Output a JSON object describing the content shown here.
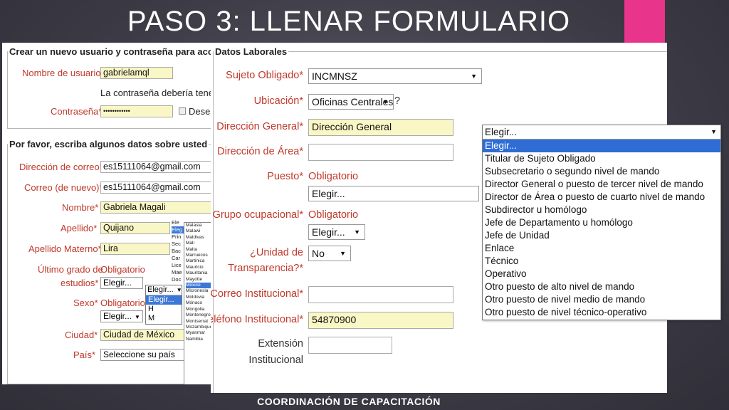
{
  "slide": {
    "title": "PASO 3: LLENAR FORMULARIO",
    "footer": "COORDINACIÓN DE CAPACITACIÓN"
  },
  "account": {
    "legend": "Crear un nuevo usuario y contraseña para acce",
    "username_label": "Nombre de usuario*",
    "username_value": "gabrielamql",
    "password_hint": "La contraseña debería tene",
    "password_label": "Contraseña*",
    "password_value": "••••••••••••",
    "unmask_label": "Desen"
  },
  "personal": {
    "legend": "Por favor, escriba algunos datos sobre usted",
    "email_label": "Dirección de correo*",
    "email_value": "es15111064@gmail.com",
    "email2_label": "Correo (de nuevo)*",
    "email2_value": "es15111064@gmail.com",
    "name_label": "Nombre*",
    "name_value": "Gabriela Magali",
    "surname_label": "Apellido*",
    "surname_value": "Quijano",
    "surname2_label": "Apellido Materno*",
    "surname2_value": "Lira",
    "grade_label_1": "Último grado de",
    "grade_label_2": "estudios*",
    "grade_note": "Obligatorio",
    "grade_select": "Elegir...",
    "sex_label": "Sexo*",
    "sex_note": "Obligatorio",
    "sex_select": "Elegir...",
    "sex_options": [
      "Elegir...",
      "H",
      "M"
    ],
    "sex_header": "Elegir...",
    "city_label": "Ciudad*",
    "city_value": "Ciudad de México",
    "country_label": "País*",
    "country_select": "Seleccione su país",
    "country_partial": [
      "Ele",
      "Eleg",
      "Prin",
      "Sec",
      "Bac",
      "Car",
      "Lice",
      "Mae",
      "Doc"
    ],
    "countries": [
      "Malasia",
      "Malawi",
      "Maldivas",
      "Mali",
      "Malta",
      "Marruecos",
      "Martinica",
      "Mauricio",
      "Mauritania",
      "Mayotte",
      "México",
      "Micronesia",
      "Moldovia",
      "Mónaco",
      "Mongolia",
      "Montenegro",
      "Montserrat",
      "Mozambique",
      "Myanmar",
      "Namibia"
    ]
  },
  "work": {
    "legend": "Datos Laborales",
    "obligado_label": "Sujeto Obligado*",
    "obligado_value": "INCMNSZ",
    "ubicacion_label": "Ubicación*",
    "ubicacion_value": "Oficinas Centrales",
    "ubicacion_help": "?",
    "dir_general_label": "Dirección General*",
    "dir_general_value": "Dirección General",
    "dir_area_label": "Dirección de Área*",
    "dir_area_value": "",
    "puesto_label": "Puesto*",
    "puesto_note": "Obligatorio",
    "puesto_select": "Elegir...",
    "grupo_label": "Grupo ocupacional*",
    "grupo_note": "Obligatorio",
    "grupo_select": "Elegir...",
    "unidad_label_1": "¿Unidad de",
    "unidad_label_2": "Transparencia?*",
    "unidad_select": "No",
    "correo_label": "Correo Institucional*",
    "correo_value": "",
    "telefono_label": "Teléfono Institucional*",
    "telefono_value": "54870900",
    "extension_label_1": "Extensión",
    "extension_label_2": "Institucional",
    "extension_value": ""
  },
  "dropdown": {
    "header": "Elegir...",
    "options": [
      "Elegir...",
      "Titular de Sujeto Obligado",
      "Subsecretario o segundo nivel de mando",
      "Director General o puesto de tercer nivel de mando",
      "Director de Área o puesto de cuarto nivel de mando",
      "Subdirector u homólogo",
      "Jefe de Departamento u homólogo",
      "Jefe de Unidad",
      "Enlace",
      "Técnico",
      "Operativo",
      "Otro puesto de alto nivel de mando",
      "Otro puesto de nivel medio de mando",
      "Otro puesto de nivel técnico-operativo"
    ],
    "selected_index": 0
  },
  "colors": {
    "accent_pink": "#e9348b",
    "required_red": "#c0392b",
    "highlight_yellow": "#faf7c6",
    "selection_blue": "#2f6dd5"
  }
}
